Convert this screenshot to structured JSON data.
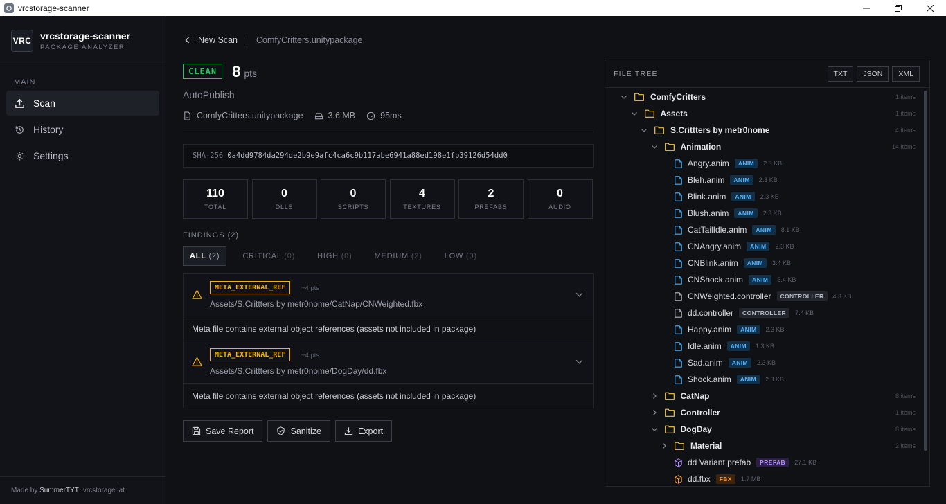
{
  "window": {
    "title": "vrcstorage-scanner"
  },
  "brand": {
    "logo": "VRC",
    "name": "vrcstorage-scanner",
    "tagline": "PACKAGE ANALYZER"
  },
  "sidebar": {
    "section": "MAIN",
    "items": [
      {
        "label": "Scan",
        "icon": "upload-icon",
        "active": true
      },
      {
        "label": "History",
        "icon": "history-icon",
        "active": false
      },
      {
        "label": "Settings",
        "icon": "gear-icon",
        "active": false
      }
    ],
    "footer": {
      "prefix": "Made by ",
      "author": "SummerTYT",
      "suffix": " · vrcstorage.lat"
    }
  },
  "breadcrumb": {
    "back": "New Scan",
    "file": "ComfyCritters.unitypackage"
  },
  "result": {
    "status": "CLEAN",
    "score": "8",
    "score_unit": "pts",
    "author": "AutoPublish",
    "filename": "ComfyCritters.unitypackage",
    "size": "3.6 MB",
    "duration": "95ms",
    "sha_label": "SHA-256",
    "sha": "0a4dd9784da294de2b9e9afc4ca6c9b117abe6941a88ed198e1fb39126d54dd0"
  },
  "stats": [
    {
      "value": "110",
      "label": "TOTAL"
    },
    {
      "value": "0",
      "label": "DLLS"
    },
    {
      "value": "0",
      "label": "SCRIPTS"
    },
    {
      "value": "4",
      "label": "TEXTURES"
    },
    {
      "value": "2",
      "label": "PREFABS"
    },
    {
      "value": "0",
      "label": "AUDIO"
    }
  ],
  "findings": {
    "label": "FINDINGS (2)",
    "tabs": [
      {
        "label": "ALL",
        "count": "(2)",
        "active": true
      },
      {
        "label": "CRITICAL",
        "count": "(0)"
      },
      {
        "label": "HIGH",
        "count": "(0)"
      },
      {
        "label": "MEDIUM",
        "count": "(2)"
      },
      {
        "label": "LOW",
        "count": "(0)"
      }
    ],
    "items": [
      {
        "tag": "META_EXTERNAL_REF",
        "points": "+4 pts",
        "path": "Assets/S.Crittters by metr0nome/CatNap/CNWeighted.fbx",
        "description": "Meta file contains external object references (assets not included in package)"
      },
      {
        "tag": "META_EXTERNAL_REF",
        "points": "+4 pts",
        "path": "Assets/S.Crittters by metr0nome/DogDay/dd.fbx",
        "description": "Meta file contains external object references (assets not included in package)"
      }
    ]
  },
  "actions": {
    "save": "Save Report",
    "sanitize": "Sanitize",
    "export": "Export"
  },
  "file_tree": {
    "label": "FILE TREE",
    "formats": [
      "TXT",
      "JSON",
      "XML"
    ],
    "rows": [
      {
        "depth": 0,
        "type": "folder",
        "open": true,
        "name": "ComfyCritters",
        "count": "1 items"
      },
      {
        "depth": 1,
        "type": "folder",
        "open": true,
        "name": "Assets",
        "count": "1 items"
      },
      {
        "depth": 2,
        "type": "folder",
        "open": true,
        "name": "S.Crittters by metr0nome",
        "count": "4 items"
      },
      {
        "depth": 3,
        "type": "folder",
        "open": true,
        "name": "Animation",
        "count": "14 items"
      },
      {
        "depth": 4,
        "type": "file",
        "name": "Angry.anim",
        "badge": "ANIM",
        "kind": "anim",
        "size": "2.3 KB"
      },
      {
        "depth": 4,
        "type": "file",
        "name": "Bleh.anim",
        "badge": "ANIM",
        "kind": "anim",
        "size": "2.3 KB"
      },
      {
        "depth": 4,
        "type": "file",
        "name": "Blink.anim",
        "badge": "ANIM",
        "kind": "anim",
        "size": "2.3 KB"
      },
      {
        "depth": 4,
        "type": "file",
        "name": "Blush.anim",
        "badge": "ANIM",
        "kind": "anim",
        "size": "2.3 KB"
      },
      {
        "depth": 4,
        "type": "file",
        "name": "CatTailIdle.anim",
        "badge": "ANIM",
        "kind": "anim",
        "size": "8.1 KB"
      },
      {
        "depth": 4,
        "type": "file",
        "name": "CNAngry.anim",
        "badge": "ANIM",
        "kind": "anim",
        "size": "2.3 KB"
      },
      {
        "depth": 4,
        "type": "file",
        "name": "CNBlink.anim",
        "badge": "ANIM",
        "kind": "anim",
        "size": "3.4 KB"
      },
      {
        "depth": 4,
        "type": "file",
        "name": "CNShock.anim",
        "badge": "ANIM",
        "kind": "anim",
        "size": "3.4 KB"
      },
      {
        "depth": 4,
        "type": "file",
        "name": "CNWeighted.controller",
        "badge": "CONTROLLER",
        "kind": "ctrl",
        "size": "4.3 KB"
      },
      {
        "depth": 4,
        "type": "file",
        "name": "dd.controller",
        "badge": "CONTROLLER",
        "kind": "ctrl",
        "size": "7.4 KB"
      },
      {
        "depth": 4,
        "type": "file",
        "name": "Happy.anim",
        "badge": "ANIM",
        "kind": "anim",
        "size": "2.3 KB"
      },
      {
        "depth": 4,
        "type": "file",
        "name": "Idle.anim",
        "badge": "ANIM",
        "kind": "anim",
        "size": "1.3 KB"
      },
      {
        "depth": 4,
        "type": "file",
        "name": "Sad.anim",
        "badge": "ANIM",
        "kind": "anim",
        "size": "2.3 KB"
      },
      {
        "depth": 4,
        "type": "file",
        "name": "Shock.anim",
        "badge": "ANIM",
        "kind": "anim",
        "size": "2.3 KB"
      },
      {
        "depth": 3,
        "type": "folder",
        "open": false,
        "name": "CatNap",
        "count": "8 items"
      },
      {
        "depth": 3,
        "type": "folder",
        "open": false,
        "name": "Controller",
        "count": "1 items"
      },
      {
        "depth": 3,
        "type": "folder",
        "open": true,
        "name": "DogDay",
        "count": "8 items"
      },
      {
        "depth": 4,
        "type": "folder",
        "open": false,
        "name": "Material",
        "count": "2 items"
      },
      {
        "depth": 4,
        "type": "file",
        "name": "dd Variant.prefab",
        "badge": "PREFAB",
        "kind": "prefab",
        "size": "27.1 KB"
      },
      {
        "depth": 4,
        "type": "file",
        "name": "dd.fbx",
        "badge": "FBX",
        "kind": "fbx",
        "size": "1.7 MB"
      }
    ]
  },
  "colors": {
    "clean": "#22c55e",
    "warning": "#f5b40a",
    "folder": "#f5c542",
    "file": "#4fb3ff"
  }
}
